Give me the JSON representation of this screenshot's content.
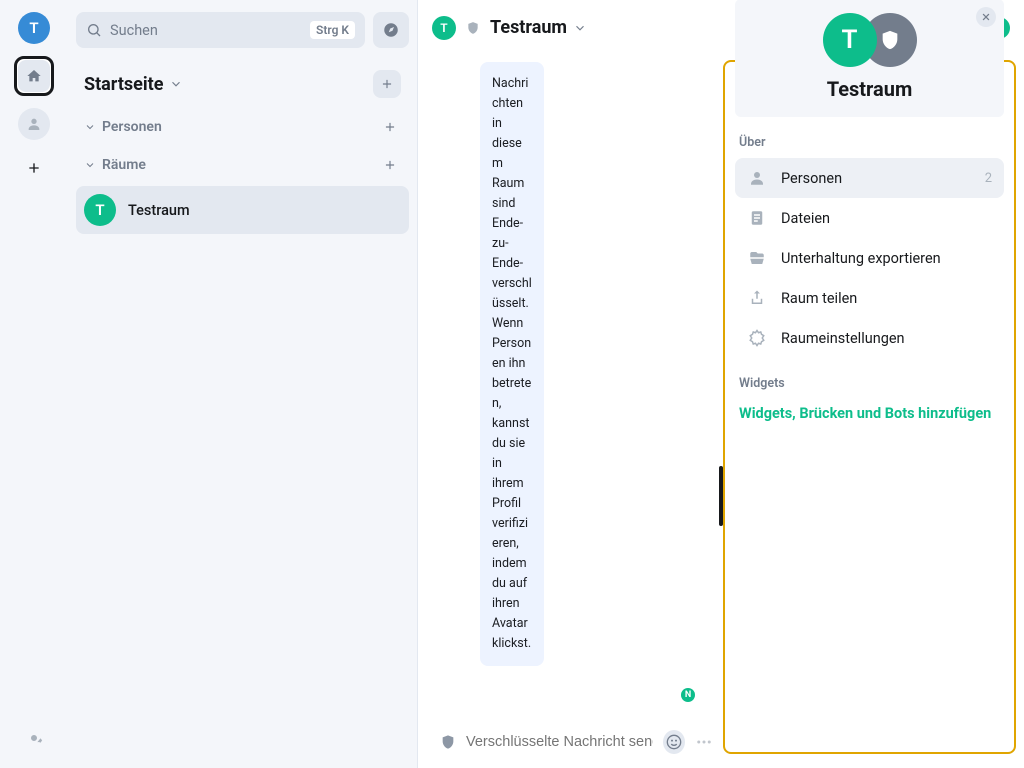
{
  "user": {
    "initial": "T"
  },
  "rail": {
    "home_title": "Startseite",
    "people_title": "Personen"
  },
  "search": {
    "placeholder": "Suchen",
    "shortcut": "Strg K"
  },
  "home": {
    "title": "Startseite"
  },
  "sections": {
    "people": "Personen",
    "rooms": "Räume"
  },
  "rooms": [
    {
      "initial": "T",
      "name": "Testraum",
      "active": true
    }
  ],
  "room_header": {
    "initial": "T",
    "name": "Testraum"
  },
  "timeline": {
    "e2e_notice": "Nachrichten in diesem Raum sind Ende-zu-Ende-verschlüsselt. Wenn Personen ihn betreten, kannst du sie in ihrem Profil verifizieren, indem du auf ihren Avatar klickst.",
    "read_receipt_initial": "N"
  },
  "composer": {
    "placeholder": "Verschlüsselte Nachricht senden …"
  },
  "right_panel": {
    "room_initial": "T",
    "room_name": "Testraum",
    "about_label": "Über",
    "items": {
      "people": {
        "label": "Personen",
        "count": "2"
      },
      "files": {
        "label": "Dateien"
      },
      "export": {
        "label": "Unterhaltung exportieren"
      },
      "share": {
        "label": "Raum teilen"
      },
      "settings": {
        "label": "Raumeinstellungen"
      }
    },
    "widgets_label": "Widgets",
    "widgets_link": "Widgets, Brücken und Bots hinzufügen"
  }
}
